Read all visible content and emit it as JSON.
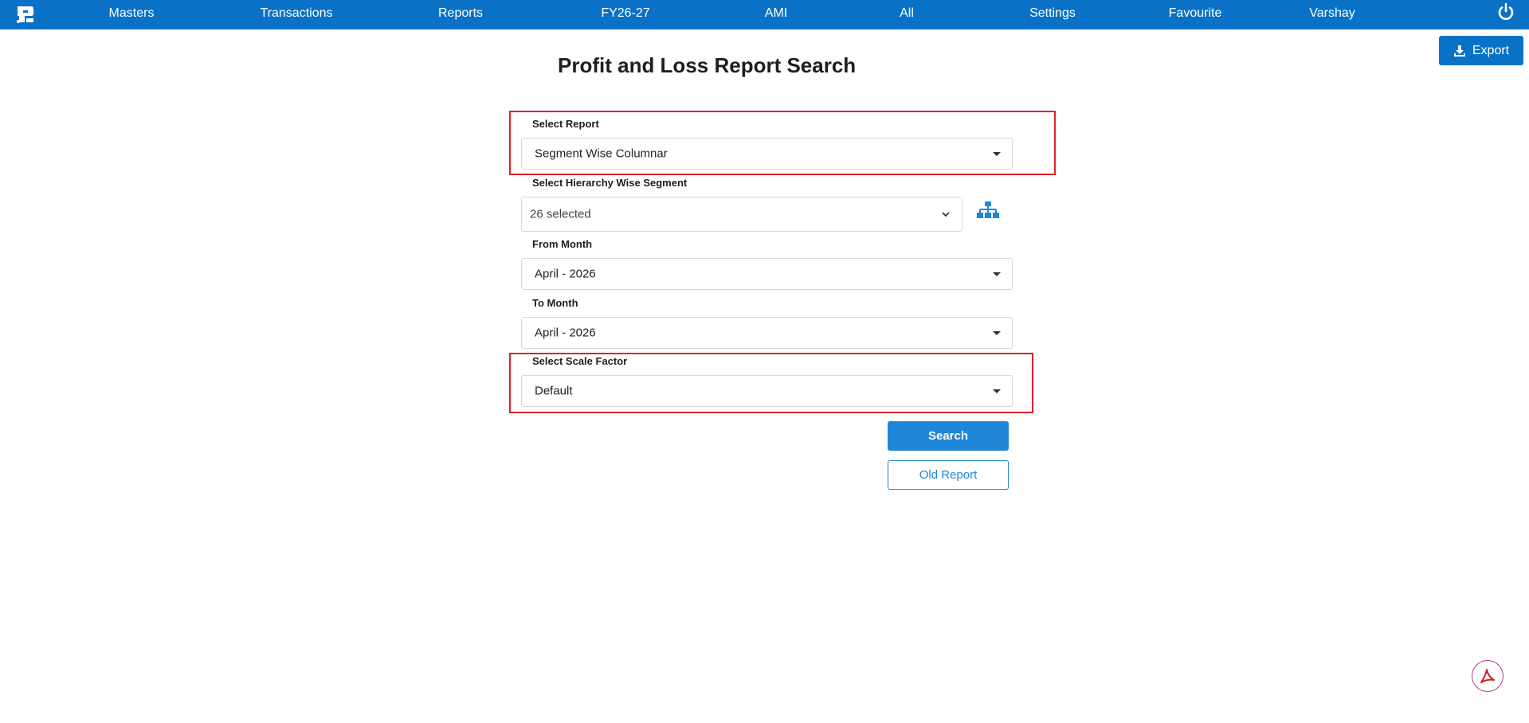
{
  "nav": {
    "items": [
      "Masters",
      "Transactions",
      "Reports",
      "FY26-27",
      "AMI",
      "All",
      "Settings",
      "Favourite",
      "Varshay"
    ]
  },
  "header_icons": {
    "logo": "logo-icon",
    "power": "power-icon"
  },
  "toolbar": {
    "export_label": "Export",
    "export_icon": "download-icon"
  },
  "page": {
    "title": "Profit and Loss Report Search"
  },
  "form": {
    "select_report": {
      "label": "Select Report",
      "value": "Segment Wise Columnar"
    },
    "segment": {
      "label": "Select Hierarchy Wise Segment",
      "value": "26 selected",
      "icon": "hierarchy-icon"
    },
    "from_month": {
      "label": "From Month",
      "value": "April - 2026"
    },
    "to_month": {
      "label": "To Month",
      "value": "April - 2026"
    },
    "scale_factor": {
      "label": "Select Scale Factor",
      "value": "Default"
    }
  },
  "actions": {
    "search_label": "Search",
    "old_report_label": "Old Report"
  },
  "floating": {
    "pdf_icon": "pdf-icon"
  },
  "colors": {
    "primary": "#0a72c6",
    "button": "#1f86d8",
    "highlight": "#e0202a"
  }
}
